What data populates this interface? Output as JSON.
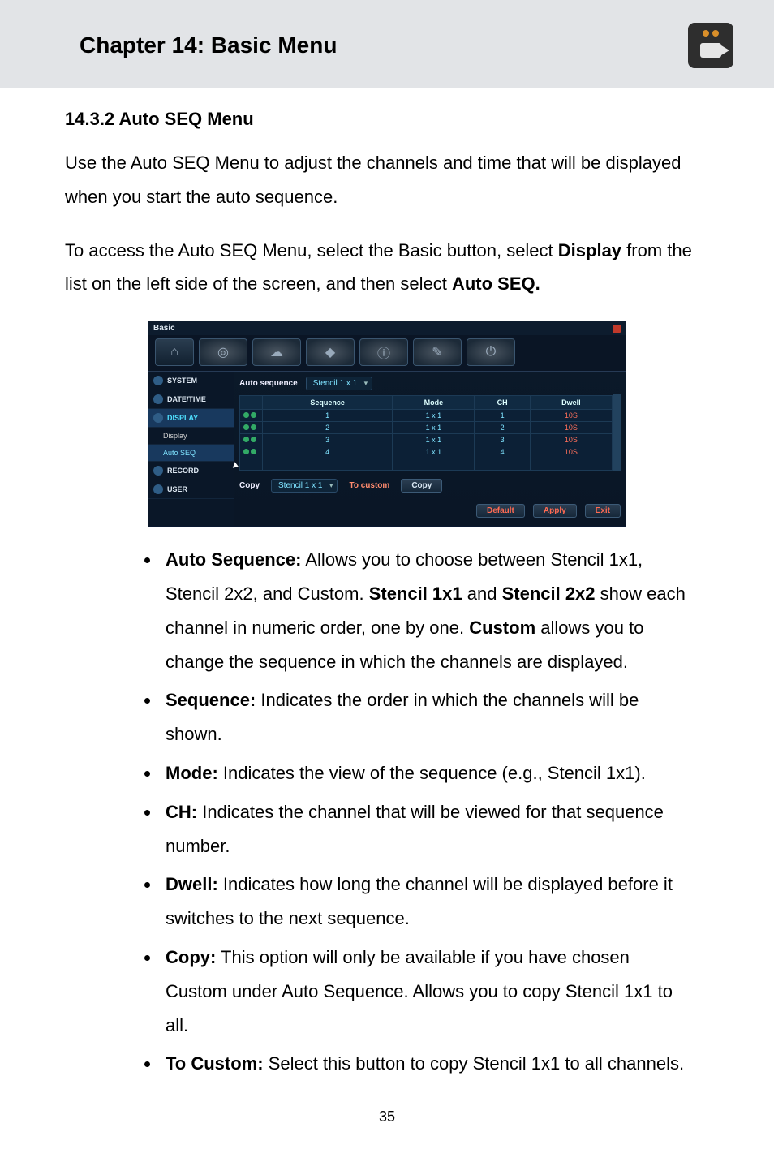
{
  "header": {
    "chapter_title": "Chapter 14: Basic Menu",
    "icon_name": "camera-icon"
  },
  "section": {
    "number_title": "14.3.2 Auto SEQ Menu",
    "intro": "Use the Auto SEQ Menu to adjust the channels and time that will be displayed when you start the auto sequence.",
    "access_pre": "To access the Auto SEQ Menu, select the Basic button, select ",
    "access_bold1": "Display",
    "access_mid": " from the list on the left side of the screen, and then select ",
    "access_bold2": "Auto SEQ."
  },
  "dvr": {
    "window_title": "Basic",
    "toolbar_icons": [
      "home-icon",
      "target-icon",
      "cloud-icon",
      "wedge-icon",
      "info-icon",
      "brush-icon",
      "power-icon"
    ],
    "sidebar": {
      "items": [
        {
          "label": "SYSTEM"
        },
        {
          "label": "DATE/TIME"
        },
        {
          "label": "DISPLAY"
        },
        {
          "label": "Display"
        },
        {
          "label": "Auto SEQ"
        },
        {
          "label": "RECORD"
        },
        {
          "label": "USER"
        }
      ]
    },
    "auto_sequence_label": "Auto sequence",
    "auto_sequence_value": "Stencil 1 x 1",
    "table": {
      "headers": [
        "",
        "Sequence",
        "Mode",
        "CH",
        "Dwell"
      ],
      "rows": [
        {
          "sequence": "1",
          "mode": "1 x 1",
          "ch": "1",
          "dwell": "10S"
        },
        {
          "sequence": "2",
          "mode": "1 x 1",
          "ch": "2",
          "dwell": "10S"
        },
        {
          "sequence": "3",
          "mode": "1 x 1",
          "ch": "3",
          "dwell": "10S"
        },
        {
          "sequence": "4",
          "mode": "1 x 1",
          "ch": "4",
          "dwell": "10S"
        }
      ]
    },
    "copy_label": "Copy",
    "copy_dd_value": "Stencil 1 x 1",
    "to_custom_label": "To custom",
    "copy_btn": "Copy",
    "default_btn": "Default",
    "apply_btn": "Apply",
    "exit_btn": "Exit"
  },
  "bullets": {
    "b1_title": "Auto Sequence:",
    "b1_text_a": " Allows you to choose between Stencil 1x1, Stencil 2x2, and Custom. ",
    "b1_bold_a": "Stencil 1x1",
    "b1_text_b": " and ",
    "b1_bold_b": "Stencil 2x2",
    "b1_text_c": " show each channel in numeric order, one by one. ",
    "b1_bold_c": "Custom",
    "b1_text_d": " allows you to change the sequence in which the channels are displayed.",
    "b2_title": "Sequence:",
    "b2_text": " Indicates the order in which the channels will be shown.",
    "b3_title": "Mode:",
    "b3_text": " Indicates the view of the sequence (e.g., Stencil 1x1).",
    "b4_title": "CH:",
    "b4_text": " Indicates the channel that will be viewed for that sequence number.",
    "b5_title": "Dwell:",
    "b5_text": " Indicates how long the channel will be displayed before it switches to the next sequence.",
    "b6_title": "Copy:",
    "b6_text": " This option will only be available if you have chosen Custom under Auto Sequence. Allows you to copy Stencil 1x1 to all.",
    "b7_title": "To Custom:",
    "b7_text": " Select this button to copy Stencil 1x1 to all channels."
  },
  "page_number": "35"
}
